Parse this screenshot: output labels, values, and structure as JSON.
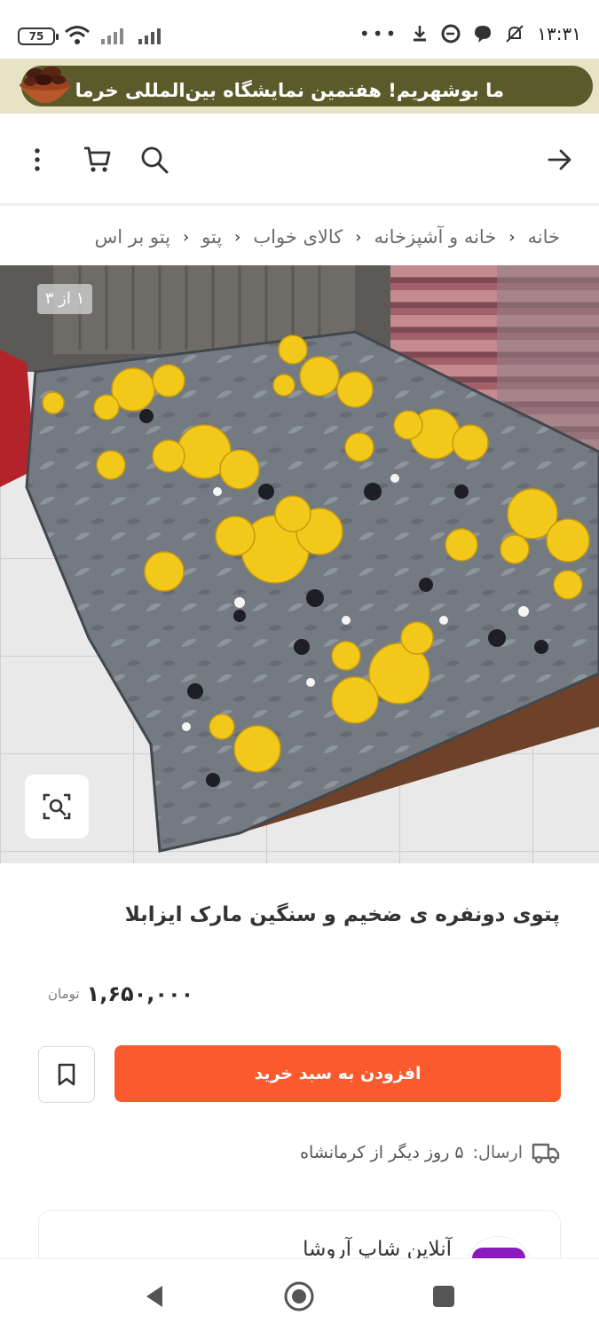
{
  "status_bar": {
    "battery": "75",
    "time": "۱۳:۳۱",
    "overflow": "•••"
  },
  "promo": {
    "text": "ما بوشهریم! هفتمین نمایشگاه بین‌المللی خرما"
  },
  "breadcrumb": [
    "خانه",
    "خانه و آشپزخانه",
    "کالای خواب",
    "پتو",
    "پتو بر اس"
  ],
  "gallery": {
    "counter": "۱ از ۳",
    "current_index": 1,
    "total": 3
  },
  "product": {
    "title": "پتوی دونفره ی ضخیم و سنگین مارک ایزابلا",
    "price": "۱,۶۵۰,۰۰۰",
    "currency": "تومان",
    "add_to_cart_label": "افزودن به سبد خرید",
    "shipping_label": "ارسال:",
    "shipping_value": "۵ روز دیگر از کرمانشاه"
  },
  "seller": {
    "name": "آنلاین شاپ آروشا"
  },
  "colors": {
    "accent": "#fa5a2d",
    "promo_bg": "#5b5a2b",
    "promo_strip": "#e8e3c4",
    "seller_brand": "#8a1bbf"
  },
  "icons": [
    "wifi-icon",
    "signal-icon",
    "download-icon",
    "edge-icon",
    "chat-icon",
    "mute-icon",
    "back-arrow-icon",
    "search-icon",
    "cart-icon",
    "more-vertical-icon",
    "image-search-icon",
    "bookmark-icon",
    "truck-icon",
    "nav-back-icon",
    "nav-home-icon",
    "nav-recents-icon"
  ]
}
